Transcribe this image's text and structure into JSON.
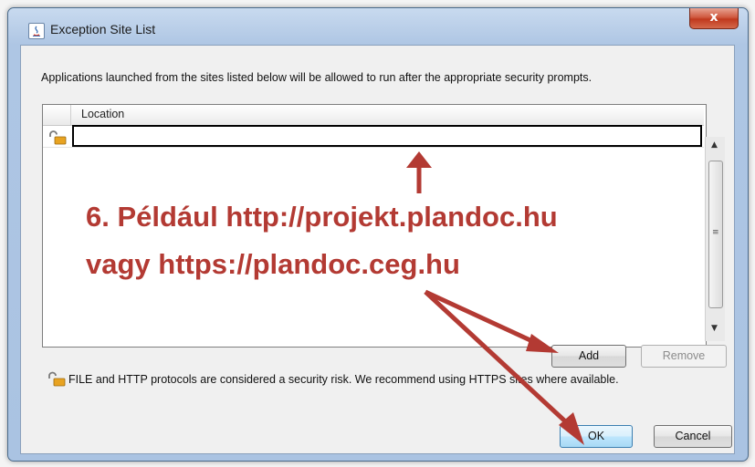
{
  "window": {
    "title": "Exception Site List",
    "close_label": "x"
  },
  "description": "Applications launched from the sites listed below will be allowed to run after the appropriate security prompts.",
  "table": {
    "columns": [
      "Location"
    ],
    "rows": [
      {
        "location": ""
      }
    ]
  },
  "buttons": {
    "add": "Add",
    "remove": "Remove",
    "ok": "OK",
    "cancel": "Cancel"
  },
  "warning": "FILE and HTTP protocols are considered a security risk.  We recommend using HTTPS sites where available.",
  "annotation": {
    "line1": "6. Például http://projekt.plandoc.hu",
    "line2": "vagy https://plandoc.ceg.hu",
    "color": "#b33a33"
  },
  "icons": {
    "title": "java-icon",
    "row": "lock-icon",
    "warning": "lock-icon"
  }
}
